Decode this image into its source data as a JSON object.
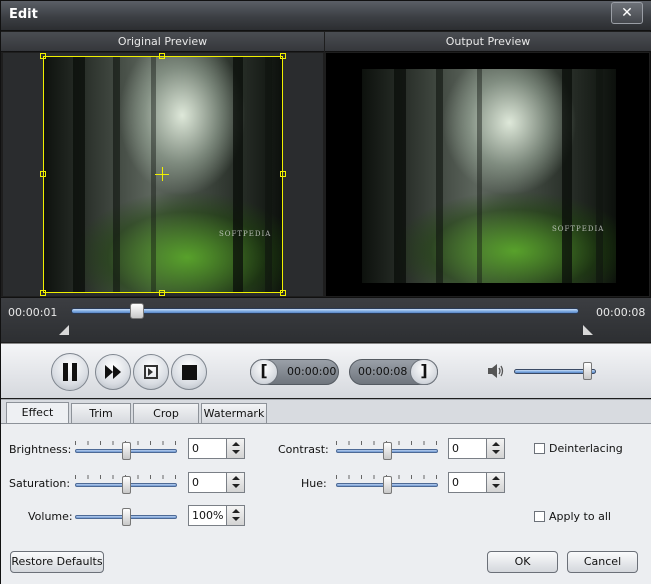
{
  "window": {
    "title": "Edit",
    "close_glyph": "✕"
  },
  "preview": {
    "original_label": "Original Preview",
    "output_label": "Output Preview",
    "watermark": "SOFTPEDIA"
  },
  "timeline": {
    "start_time": "00:00:01",
    "end_time": "00:00:08",
    "position": 0.12
  },
  "controls": {
    "trim_start": "00:00:00",
    "trim_end": "00:00:08",
    "bracket_left": "[",
    "bracket_right": "]",
    "volume_level": 0.95
  },
  "tabs": [
    "Effect",
    "Trim",
    "Crop",
    "Watermark"
  ],
  "effect": {
    "brightness": {
      "label": "Brightness:",
      "value": "0",
      "level": 0.5
    },
    "contrast": {
      "label": "Contrast:",
      "value": "0",
      "level": 0.5
    },
    "saturation": {
      "label": "Saturation:",
      "value": "0",
      "level": 0.5
    },
    "hue": {
      "label": "Hue:",
      "value": "0",
      "level": 0.5
    },
    "volume": {
      "label": "Volume:",
      "value": "100%",
      "level": 0.5
    },
    "deinterlacing": {
      "label": "Deinterlacing",
      "checked": false
    },
    "apply_to_all": {
      "label": "Apply to all",
      "checked": false
    }
  },
  "buttons": {
    "restore": "Restore Defaults",
    "ok": "OK",
    "cancel": "Cancel"
  },
  "colors": {
    "crop_frame": "#f0f000",
    "slider_blue": "#7aa8e0"
  }
}
